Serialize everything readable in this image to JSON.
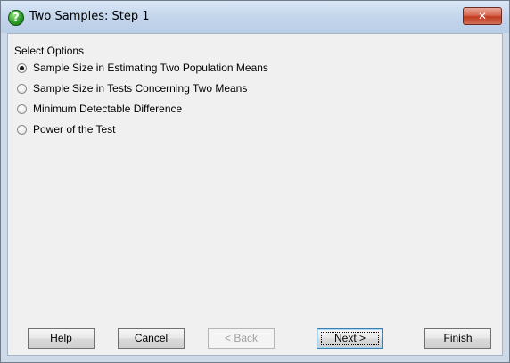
{
  "window": {
    "title": "Two Samples: Step 1",
    "close_icon": "close-x-icon"
  },
  "options": {
    "group_label": "Select Options",
    "items": [
      {
        "label": "Sample Size in Estimating Two Population Means",
        "selected": true
      },
      {
        "label": "Sample Size in Tests Concerning Two Means",
        "selected": false
      },
      {
        "label": "Minimum Detectable Difference",
        "selected": false
      },
      {
        "label": "Power of the Test",
        "selected": false
      }
    ]
  },
  "buttons": {
    "help": "Help",
    "cancel": "Cancel",
    "back": "< Back",
    "next": "Next >",
    "finish": "Finish"
  }
}
